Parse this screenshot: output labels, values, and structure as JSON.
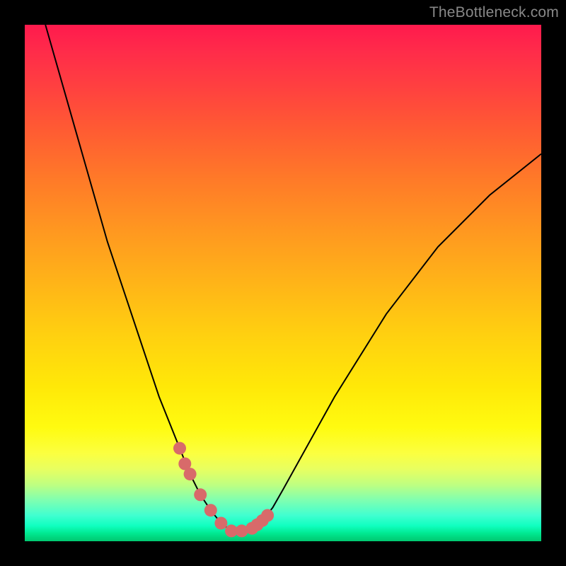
{
  "watermark": "TheBottleneck.com",
  "chart_data": {
    "type": "line",
    "title": "",
    "xlabel": "",
    "ylabel": "",
    "xlim": [
      0,
      100
    ],
    "ylim": [
      0,
      100
    ],
    "series": [
      {
        "name": "bottleneck-curve",
        "x": [
          4,
          6,
          8,
          10,
          12,
          14,
          16,
          18,
          20,
          22,
          24,
          26,
          28,
          30,
          32,
          34,
          36,
          38,
          40,
          42,
          44,
          46,
          48,
          50,
          60,
          70,
          80,
          90,
          100
        ],
        "y": [
          100,
          93,
          86,
          79,
          72,
          65,
          58,
          52,
          46,
          40,
          34,
          28,
          23,
          18,
          13,
          9,
          6,
          3.5,
          2,
          2,
          2.5,
          4,
          6.5,
          10,
          28,
          44,
          57,
          67,
          75
        ]
      }
    ],
    "highlight_points": {
      "name": "bottleneck-range-dots",
      "color": "#d86a6a",
      "x": [
        30,
        31,
        32,
        34,
        36,
        38,
        40,
        42,
        44,
        45,
        46,
        47
      ],
      "y": [
        18,
        15,
        13,
        9,
        6,
        3.5,
        2,
        2,
        2.5,
        3.2,
        4,
        5
      ]
    },
    "gradient_scale": {
      "top": "high-bottleneck",
      "bottom": "no-bottleneck",
      "top_color": "#ff1a4d",
      "bottom_color": "#00c870"
    }
  }
}
